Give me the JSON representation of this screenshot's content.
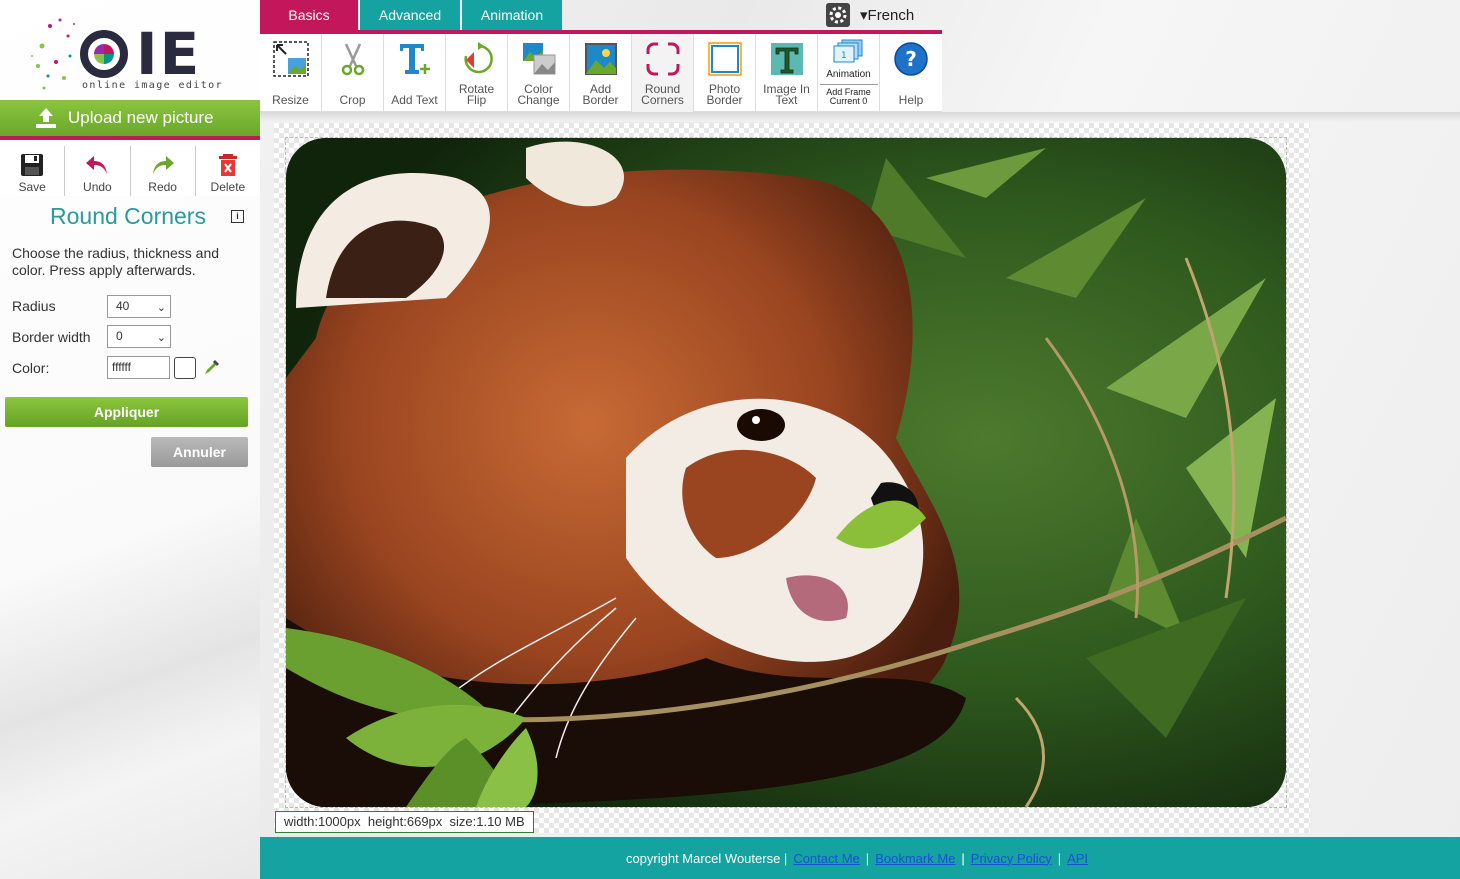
{
  "logo": {
    "letters": "IE",
    "tagline": "online image editor"
  },
  "upload": {
    "label": "Upload new picture"
  },
  "actions": [
    {
      "label": "Save"
    },
    {
      "label": "Undo"
    },
    {
      "label": "Redo"
    },
    {
      "label": "Delete"
    }
  ],
  "panel": {
    "title": "Round Corners",
    "info": "i",
    "description": "Choose the radius, thickness and color. Press apply afterwards.",
    "radius_label": "Radius",
    "radius_value": "40",
    "border_label": "Border width",
    "border_value": "0",
    "color_label": "Color:",
    "color_value": "ffffff",
    "apply_label": "Appliquer",
    "cancel_label": "Annuler"
  },
  "tabs": [
    {
      "label": "Basics"
    },
    {
      "label": "Advanced"
    },
    {
      "label": "Animation"
    }
  ],
  "language": "▾French",
  "tools": [
    {
      "line1": "",
      "line2": "Resize",
      "icon": "resize-icon"
    },
    {
      "line1": "",
      "line2": "Crop",
      "icon": "scissors-icon"
    },
    {
      "line1": "",
      "line2": "Add Text",
      "icon": "text-icon"
    },
    {
      "line1": "Rotate",
      "line2": "Flip",
      "icon": "rotate-icon"
    },
    {
      "line1": "Color",
      "line2": "Change",
      "icon": "color-change-icon"
    },
    {
      "line1": "Add",
      "line2": "Border",
      "icon": "picture-icon"
    },
    {
      "line1": "Round",
      "line2": "Corners",
      "icon": "round-corners-icon"
    },
    {
      "line1": "Photo",
      "line2": "Border",
      "icon": "photo-border-icon"
    },
    {
      "line1": "Image In",
      "line2": "Text",
      "icon": "image-in-text-icon"
    },
    {
      "line1": "Animation",
      "line2": "Add Frame",
      "line3": "Current 0",
      "icon": "animation-icon"
    },
    {
      "line1": "",
      "line2": "Help",
      "icon": "help-icon"
    }
  ],
  "image_info": "width:1000px  height:669px  size:1.10 MB",
  "footer": {
    "copyright": "copyright Marcel Wouterse |",
    "links": [
      "Contact Me",
      "Bookmark Me",
      "Privacy Policy",
      "API"
    ]
  },
  "colors": {
    "accent_pink": "#c2185b",
    "accent_teal": "#14a3a0",
    "accent_green": "#8bc53f"
  }
}
